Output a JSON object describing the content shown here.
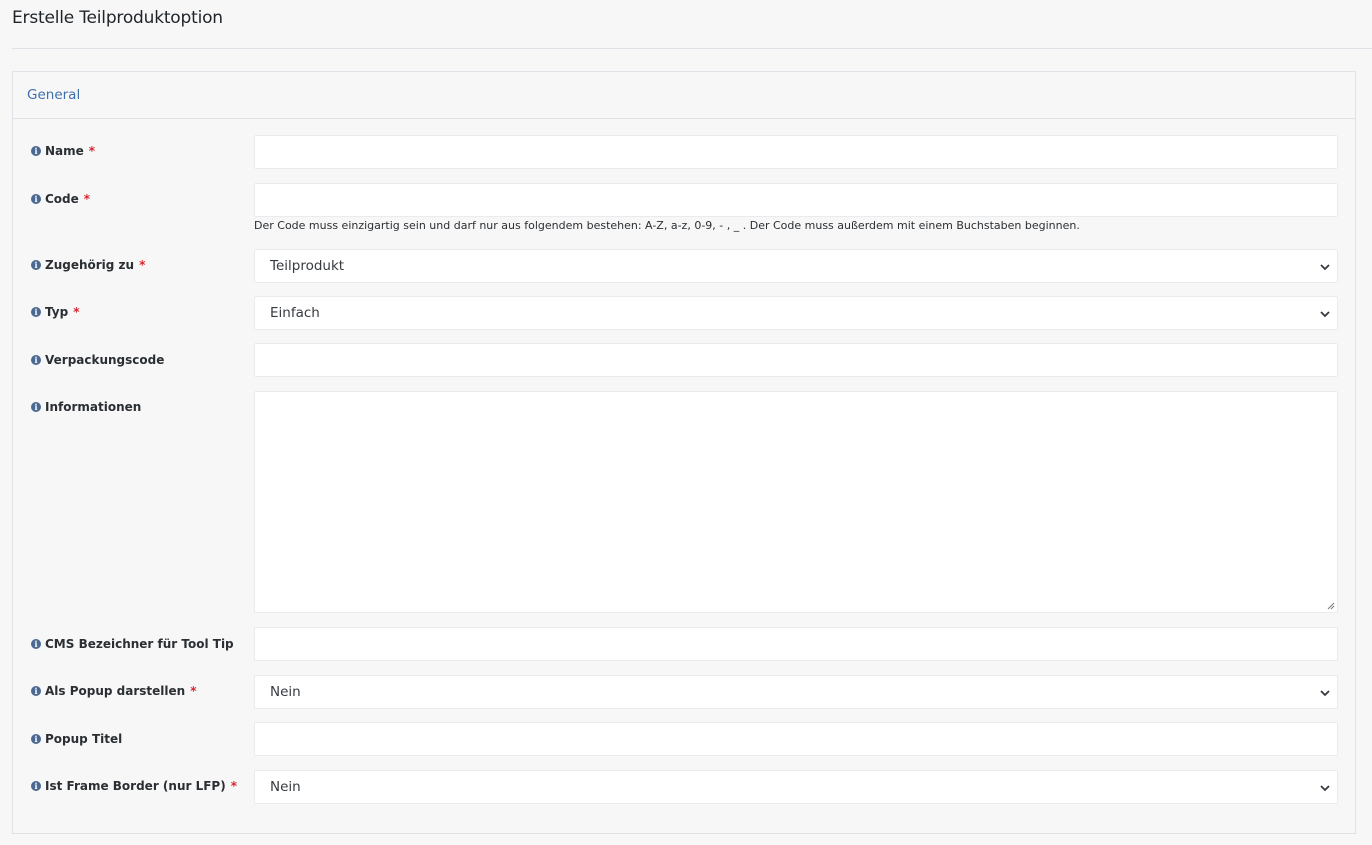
{
  "page": {
    "title": "Erstelle Teilproduktoption"
  },
  "section": {
    "title": "General"
  },
  "fields": {
    "name": {
      "label": "Name",
      "required": "*",
      "value": ""
    },
    "code": {
      "label": "Code",
      "required": "*",
      "value": "",
      "help": "Der Code muss einzigartig sein und darf nur aus folgendem bestehen: A-Z, a-z, 0-9, - , _ . Der Code muss außerdem mit einem Buchstaben beginnen."
    },
    "belongs_to": {
      "label": "Zugehörig zu",
      "required": "*",
      "value": "Teilprodukt"
    },
    "type": {
      "label": "Typ",
      "required": "*",
      "value": "Einfach"
    },
    "packaging_code": {
      "label": "Verpackungscode",
      "value": ""
    },
    "information": {
      "label": "Informationen",
      "value": ""
    },
    "cms_tooltip": {
      "label": "CMS Bezeichner für Tool Tip",
      "value": ""
    },
    "as_popup": {
      "label": "Als Popup darstellen",
      "required": "*",
      "value": "Nein"
    },
    "popup_title": {
      "label": "Popup Titel",
      "value": ""
    },
    "frame_border": {
      "label": "Ist Frame Border (nur LFP)",
      "required": "*",
      "value": "Nein"
    }
  },
  "icons": {
    "info": "info-circle-icon",
    "select": "chevron-down-icon"
  },
  "colors": {
    "accent": "#3f6fa8",
    "required": "#d9262f",
    "info_icon": "#4a6891"
  }
}
